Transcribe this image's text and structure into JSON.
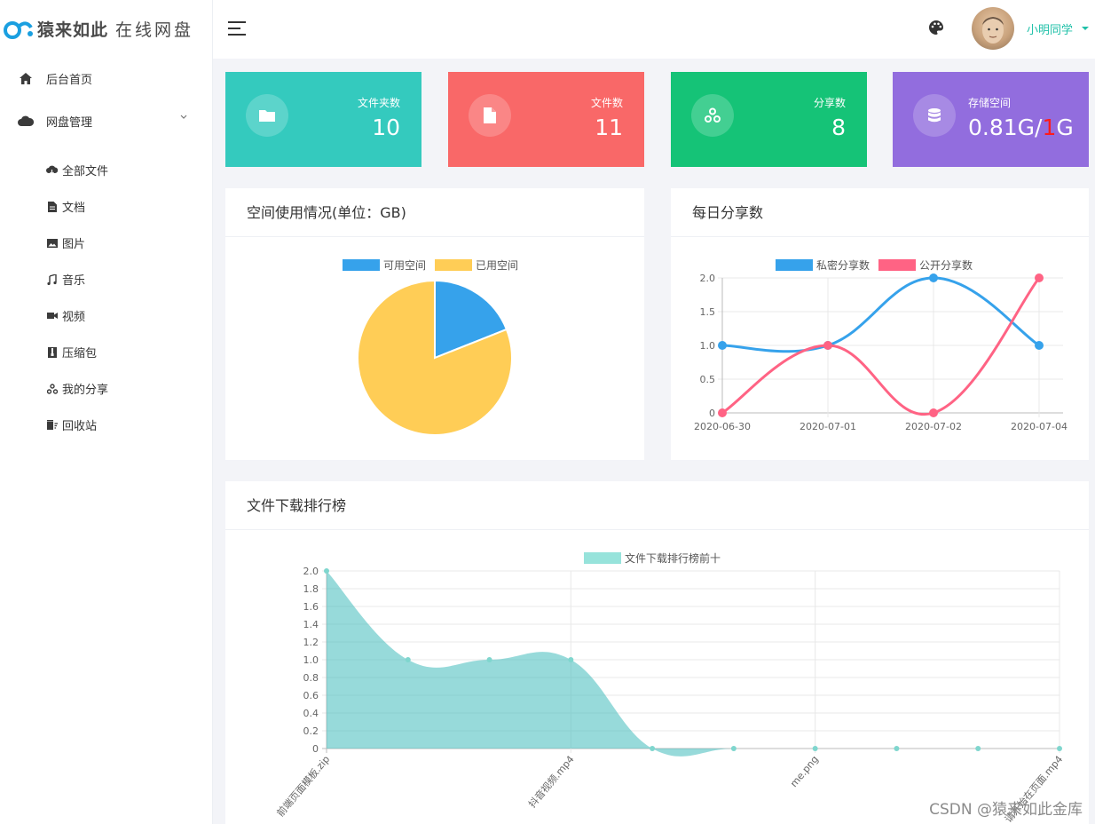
{
  "app": {
    "brand": "猿来如此",
    "subtitle": "在线网盘"
  },
  "sidebar": {
    "items": [
      {
        "label": "后台首页",
        "icon": "home-icon"
      },
      {
        "label": "网盘管理",
        "icon": "cloud-icon"
      }
    ],
    "sub_items": [
      {
        "label": "全部文件",
        "icon": "cloud-download-icon"
      },
      {
        "label": "文档",
        "icon": "document-icon"
      },
      {
        "label": "图片",
        "icon": "image-icon"
      },
      {
        "label": "音乐",
        "icon": "music-icon"
      },
      {
        "label": "视频",
        "icon": "video-icon"
      },
      {
        "label": "压缩包",
        "icon": "archive-icon"
      },
      {
        "label": "我的分享",
        "icon": "share-icon"
      },
      {
        "label": "回收站",
        "icon": "trash-icon"
      }
    ]
  },
  "header": {
    "user_name": "小明同学"
  },
  "stats": [
    {
      "label": "文件夹数",
      "value": "10",
      "color": "#34cabe",
      "icon": "folder-icon"
    },
    {
      "label": "文件数",
      "value": "11",
      "color": "#f96868",
      "icon": "file-icon"
    },
    {
      "label": "分享数",
      "value": "8",
      "color": "#15c377",
      "icon": "share-icon"
    },
    {
      "label": "存储空间",
      "value_used": "0.81G/",
      "value_total": "1",
      "value_unit": "G",
      "color": "#926dde",
      "icon": "database-icon"
    }
  ],
  "panels": {
    "space_title": "空间使用情况(单位：GB)",
    "share_title": "每日分享数",
    "download_title": "文件下载排行榜"
  },
  "chart_data": [
    {
      "type": "pie",
      "title": "空间使用情况(单位：GB)",
      "labels": [
        "可用空间",
        "已用空间"
      ],
      "values": [
        0.19,
        0.81
      ],
      "colors": [
        "#36a2eb",
        "#ffcd56"
      ]
    },
    {
      "type": "line",
      "title": "每日分享数",
      "categories": [
        "2020-06-30",
        "2020-07-01",
        "2020-07-02",
        "2020-07-04"
      ],
      "series": [
        {
          "name": "私密分享数",
          "values": [
            1,
            1,
            2,
            1
          ],
          "color": "#36a2eb"
        },
        {
          "name": "公开分享数",
          "values": [
            0,
            1,
            0,
            2
          ],
          "color": "#ff6384"
        }
      ],
      "ylim": [
        0,
        2
      ],
      "yticks": [
        "0",
        "0.5",
        "1.0",
        "1.5",
        "2.0"
      ],
      "grid": true,
      "legend": "top"
    },
    {
      "type": "area",
      "title": "文件下载排行榜",
      "series": [
        {
          "name": "文件下载排行榜前十",
          "values": [
            2,
            1,
            1,
            1,
            0,
            0,
            0,
            0,
            0,
            0
          ],
          "color": "#4bc0c0"
        }
      ],
      "categories_shown": [
        "前端页面模板.zip",
        "抖音视频.mp4",
        "me.png",
        "请开始在页面.mp4"
      ],
      "ylim": [
        0,
        2
      ],
      "yticks": [
        "0",
        "0.2",
        "0.4",
        "0.6",
        "0.8",
        "1.0",
        "1.2",
        "1.4",
        "1.6",
        "1.8",
        "2.0"
      ],
      "grid": true,
      "legend": "top"
    }
  ],
  "watermark": "CSDN @猿来如此金库"
}
